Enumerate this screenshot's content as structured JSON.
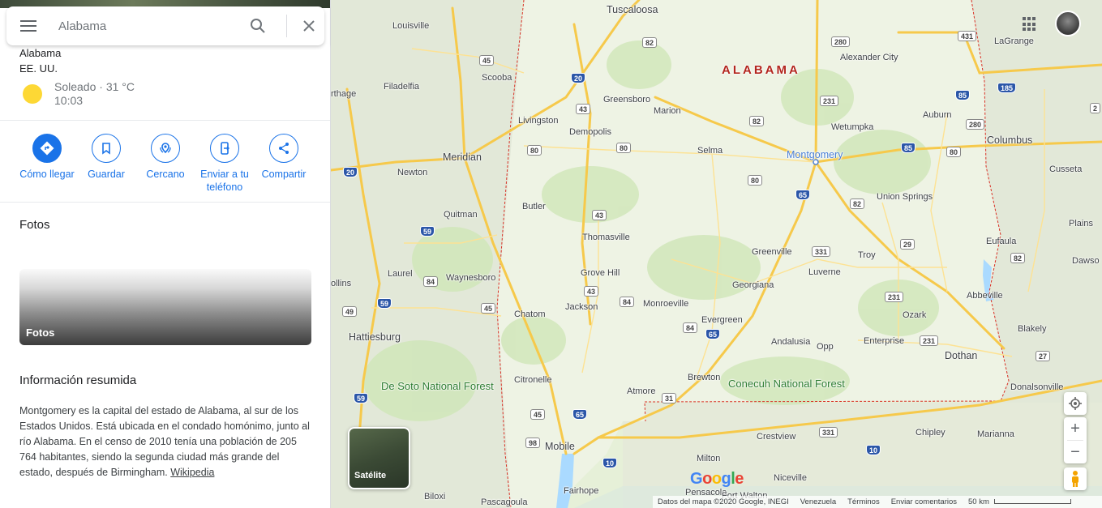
{
  "search": {
    "placeholder": "Alabama",
    "value": ""
  },
  "place": {
    "name": "Alabama",
    "country": "EE. UU."
  },
  "weather": {
    "condition": "Soleado · 31 °C",
    "time": "10:03",
    "icon": "sun-icon"
  },
  "actions": [
    {
      "label": "Cómo llegar",
      "icon": "directions-icon"
    },
    {
      "label": "Guardar",
      "icon": "bookmark-icon"
    },
    {
      "label": "Cercano",
      "icon": "nearby-icon"
    },
    {
      "label": "Enviar a tu teléfono",
      "icon": "send-to-phone-icon"
    },
    {
      "label": "Compartir",
      "icon": "share-icon"
    }
  ],
  "photos": {
    "title": "Fotos",
    "card_label": "Fotos"
  },
  "summary": {
    "title": "Información resumida",
    "text": "Montgomery es la capital del estado de Alabama, al sur de los Estados Unidos. Está ubicada en el condado homónimo, junto al río Alabama. En el censo de 2010 tenía una población de 205 764 habitantes,  siendo la segunda ciudad más grande del estado, después de Birmingham.",
    "link": "Wikipedia"
  },
  "map": {
    "state_label": "ALABAMA",
    "capital": "Montgomery",
    "cities": [
      "Tuscaloosa",
      "Louisville",
      "Scooba",
      "Filadelfia",
      "Meridian",
      "Newton",
      "Quitman",
      "Laurel",
      "Waynesboro",
      "Hattiesburg",
      "Livingston",
      "Demopolis",
      "Greensboro",
      "Marion",
      "Selma",
      "Butler",
      "Thomasville",
      "Grove Hill",
      "Jackson",
      "Chatom",
      "Citronelle",
      "Monroeville",
      "Evergreen",
      "Brewton",
      "Atmore",
      "Mobile",
      "Fairhope",
      "Pascagoula",
      "Biloxi",
      "Pensacola",
      "Milton",
      "Crestview",
      "Niceville",
      "Fort Walton",
      "Alexander City",
      "LaGrange",
      "Wetumpka",
      "Auburn",
      "Columbus",
      "Cusseta",
      "Union Springs",
      "Troy",
      "Greenville",
      "Luverne",
      "Georgiana",
      "Andalusia",
      "Opp",
      "Enterprise",
      "Ozark",
      "Dothan",
      "Eufaula",
      "Abbeville",
      "Blakely",
      "Donalsonville",
      "Chipley",
      "Marianna",
      "Plains",
      "Dawso",
      "rthage",
      "ollins"
    ],
    "forests": [
      "De Soto National Forest",
      "Conecuh National Forest"
    ],
    "satellite_label": "Satélite",
    "logo": "Google"
  },
  "footer": {
    "data": "Datos del mapa ©2020 Google, INEGI",
    "country": "Venezuela",
    "terms": "Términos",
    "feedback": "Enviar comentarios",
    "scale": "50 km"
  },
  "colors": {
    "accent": "#1a73e8",
    "state_border": "#d93025",
    "map_land": "#e6f0d8",
    "highway": "#f6c94b"
  }
}
